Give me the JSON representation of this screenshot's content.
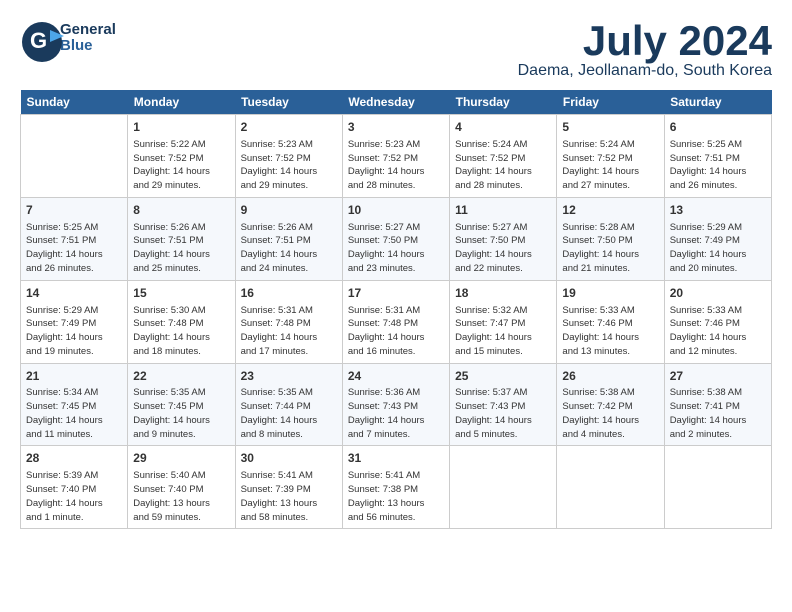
{
  "header": {
    "logo_line1": "General",
    "logo_line2": "Blue",
    "month": "July 2024",
    "location": "Daema, Jeollanam-do, South Korea"
  },
  "days_of_week": [
    "Sunday",
    "Monday",
    "Tuesday",
    "Wednesday",
    "Thursday",
    "Friday",
    "Saturday"
  ],
  "weeks": [
    [
      {
        "day": "",
        "info": ""
      },
      {
        "day": "1",
        "info": "Sunrise: 5:22 AM\nSunset: 7:52 PM\nDaylight: 14 hours\nand 29 minutes."
      },
      {
        "day": "2",
        "info": "Sunrise: 5:23 AM\nSunset: 7:52 PM\nDaylight: 14 hours\nand 29 minutes."
      },
      {
        "day": "3",
        "info": "Sunrise: 5:23 AM\nSunset: 7:52 PM\nDaylight: 14 hours\nand 28 minutes."
      },
      {
        "day": "4",
        "info": "Sunrise: 5:24 AM\nSunset: 7:52 PM\nDaylight: 14 hours\nand 28 minutes."
      },
      {
        "day": "5",
        "info": "Sunrise: 5:24 AM\nSunset: 7:52 PM\nDaylight: 14 hours\nand 27 minutes."
      },
      {
        "day": "6",
        "info": "Sunrise: 5:25 AM\nSunset: 7:51 PM\nDaylight: 14 hours\nand 26 minutes."
      }
    ],
    [
      {
        "day": "7",
        "info": "Sunrise: 5:25 AM\nSunset: 7:51 PM\nDaylight: 14 hours\nand 26 minutes."
      },
      {
        "day": "8",
        "info": "Sunrise: 5:26 AM\nSunset: 7:51 PM\nDaylight: 14 hours\nand 25 minutes."
      },
      {
        "day": "9",
        "info": "Sunrise: 5:26 AM\nSunset: 7:51 PM\nDaylight: 14 hours\nand 24 minutes."
      },
      {
        "day": "10",
        "info": "Sunrise: 5:27 AM\nSunset: 7:50 PM\nDaylight: 14 hours\nand 23 minutes."
      },
      {
        "day": "11",
        "info": "Sunrise: 5:27 AM\nSunset: 7:50 PM\nDaylight: 14 hours\nand 22 minutes."
      },
      {
        "day": "12",
        "info": "Sunrise: 5:28 AM\nSunset: 7:50 PM\nDaylight: 14 hours\nand 21 minutes."
      },
      {
        "day": "13",
        "info": "Sunrise: 5:29 AM\nSunset: 7:49 PM\nDaylight: 14 hours\nand 20 minutes."
      }
    ],
    [
      {
        "day": "14",
        "info": "Sunrise: 5:29 AM\nSunset: 7:49 PM\nDaylight: 14 hours\nand 19 minutes."
      },
      {
        "day": "15",
        "info": "Sunrise: 5:30 AM\nSunset: 7:48 PM\nDaylight: 14 hours\nand 18 minutes."
      },
      {
        "day": "16",
        "info": "Sunrise: 5:31 AM\nSunset: 7:48 PM\nDaylight: 14 hours\nand 17 minutes."
      },
      {
        "day": "17",
        "info": "Sunrise: 5:31 AM\nSunset: 7:48 PM\nDaylight: 14 hours\nand 16 minutes."
      },
      {
        "day": "18",
        "info": "Sunrise: 5:32 AM\nSunset: 7:47 PM\nDaylight: 14 hours\nand 15 minutes."
      },
      {
        "day": "19",
        "info": "Sunrise: 5:33 AM\nSunset: 7:46 PM\nDaylight: 14 hours\nand 13 minutes."
      },
      {
        "day": "20",
        "info": "Sunrise: 5:33 AM\nSunset: 7:46 PM\nDaylight: 14 hours\nand 12 minutes."
      }
    ],
    [
      {
        "day": "21",
        "info": "Sunrise: 5:34 AM\nSunset: 7:45 PM\nDaylight: 14 hours\nand 11 minutes."
      },
      {
        "day": "22",
        "info": "Sunrise: 5:35 AM\nSunset: 7:45 PM\nDaylight: 14 hours\nand 9 minutes."
      },
      {
        "day": "23",
        "info": "Sunrise: 5:35 AM\nSunset: 7:44 PM\nDaylight: 14 hours\nand 8 minutes."
      },
      {
        "day": "24",
        "info": "Sunrise: 5:36 AM\nSunset: 7:43 PM\nDaylight: 14 hours\nand 7 minutes."
      },
      {
        "day": "25",
        "info": "Sunrise: 5:37 AM\nSunset: 7:43 PM\nDaylight: 14 hours\nand 5 minutes."
      },
      {
        "day": "26",
        "info": "Sunrise: 5:38 AM\nSunset: 7:42 PM\nDaylight: 14 hours\nand 4 minutes."
      },
      {
        "day": "27",
        "info": "Sunrise: 5:38 AM\nSunset: 7:41 PM\nDaylight: 14 hours\nand 2 minutes."
      }
    ],
    [
      {
        "day": "28",
        "info": "Sunrise: 5:39 AM\nSunset: 7:40 PM\nDaylight: 14 hours\nand 1 minute."
      },
      {
        "day": "29",
        "info": "Sunrise: 5:40 AM\nSunset: 7:40 PM\nDaylight: 13 hours\nand 59 minutes."
      },
      {
        "day": "30",
        "info": "Sunrise: 5:41 AM\nSunset: 7:39 PM\nDaylight: 13 hours\nand 58 minutes."
      },
      {
        "day": "31",
        "info": "Sunrise: 5:41 AM\nSunset: 7:38 PM\nDaylight: 13 hours\nand 56 minutes."
      },
      {
        "day": "",
        "info": ""
      },
      {
        "day": "",
        "info": ""
      },
      {
        "day": "",
        "info": ""
      }
    ]
  ]
}
